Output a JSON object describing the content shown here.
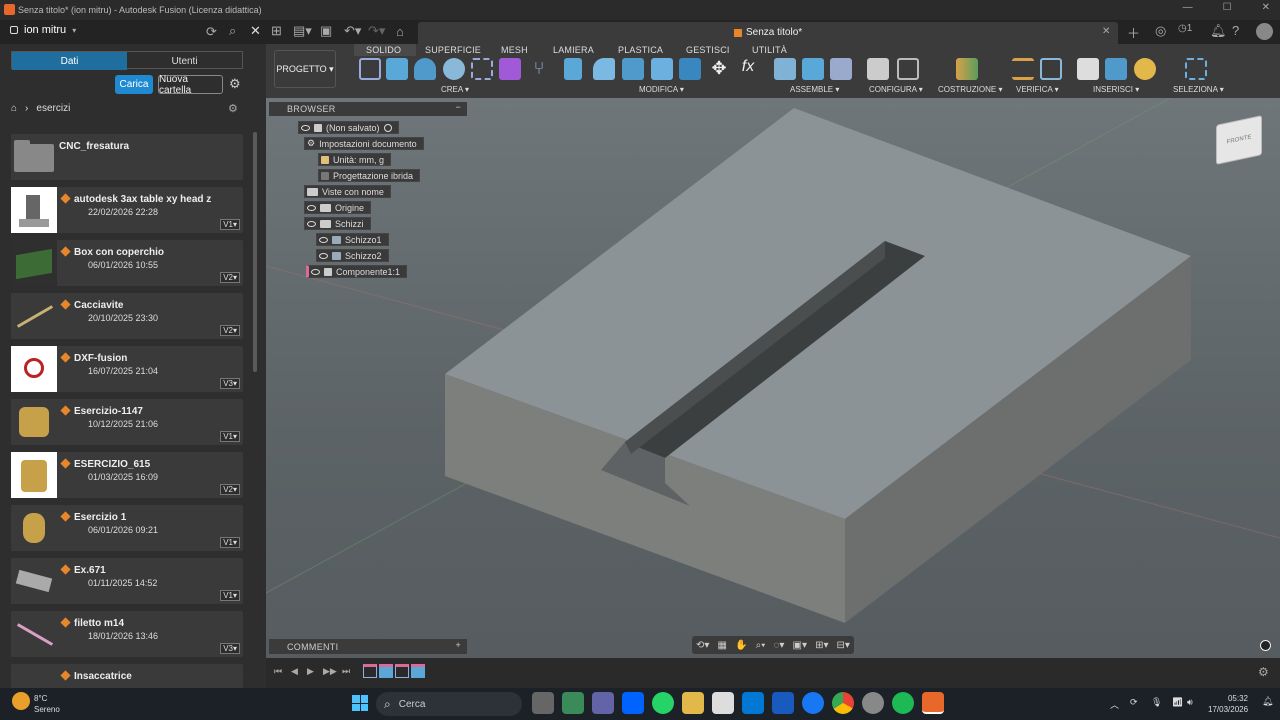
{
  "window": {
    "title": "Senza titolo* (ion mitru) - Autodesk Fusion (Licenza didattica)"
  },
  "user": {
    "name": "ion mitru"
  },
  "doc_tab": {
    "title": "Senza titolo*"
  },
  "data_panel": {
    "tabs": [
      "Dati",
      "Utenti"
    ],
    "upload_label": "Carica",
    "new_folder_label": "Nuova cartella",
    "breadcrumb": "esercizi",
    "items": [
      {
        "name": "CNC_fresatura",
        "date": "",
        "version": "",
        "kind": "folder"
      },
      {
        "name": "autodesk 3ax table xy head z",
        "date": "22/02/2026 22:28",
        "version": "V1",
        "kind": "design"
      },
      {
        "name": "Box con coperchio",
        "date": "06/01/2026 10:55",
        "version": "V2",
        "kind": "design"
      },
      {
        "name": "Cacciavite",
        "date": "20/10/2025 23:30",
        "version": "V2",
        "kind": "design"
      },
      {
        "name": "DXF-fusion",
        "date": "16/07/2025 21:04",
        "version": "V3",
        "kind": "design"
      },
      {
        "name": "Esercizio-1147",
        "date": "10/12/2025 21:06",
        "version": "V1",
        "kind": "design"
      },
      {
        "name": "ESERCIZIO_615",
        "date": "01/03/2025 16:09",
        "version": "V2",
        "kind": "design"
      },
      {
        "name": "Esercizio 1",
        "date": "06/01/2026 09:21",
        "version": "V1",
        "kind": "design"
      },
      {
        "name": "Ex.671",
        "date": "01/11/2025 14:52",
        "version": "V1",
        "kind": "design"
      },
      {
        "name": "filetto m14",
        "date": "18/01/2026 13:46",
        "version": "V3",
        "kind": "design"
      },
      {
        "name": "Insaccatrice",
        "date": "",
        "version": "",
        "kind": "design"
      }
    ]
  },
  "ribbon": {
    "workspace": "PROGETTO",
    "tabs": [
      "SOLIDO",
      "SUPERFICIE",
      "MESH",
      "LAMIERA",
      "PLASTICA",
      "GESTISCI",
      "UTILITÀ"
    ],
    "groups": [
      "CREA",
      "MODIFICA",
      "ASSEMBLE",
      "CONFIGURA",
      "COSTRUZIONE",
      "VERIFICA",
      "INSERISCI",
      "SELEZIONA"
    ]
  },
  "browser": {
    "title": "BROWSER",
    "root": "(Non salvato)",
    "settings": "Impostazioni documento",
    "units": "Unità: mm, g",
    "hybrid": "Progettazione ibrida",
    "named_views": "Viste con nome",
    "origin": "Origine",
    "sketches": "Schizzi",
    "sketch1": "Schizzo1",
    "sketch2": "Schizzo2",
    "component": "Componente1:1"
  },
  "comments": {
    "title": "COMMENTI"
  },
  "viewcube": {
    "face": "FRONTE"
  },
  "taskbar": {
    "weather_temp": "8°C",
    "weather_desc": "Sereno",
    "search_placeholder": "Cerca",
    "time": "05:32",
    "date": "17/03/2026"
  },
  "colors": {
    "accent": "#1f8ad2",
    "fusion_orange": "#e8672a",
    "body_top": "#8b9397",
    "body_side": "#7d7f7d"
  }
}
